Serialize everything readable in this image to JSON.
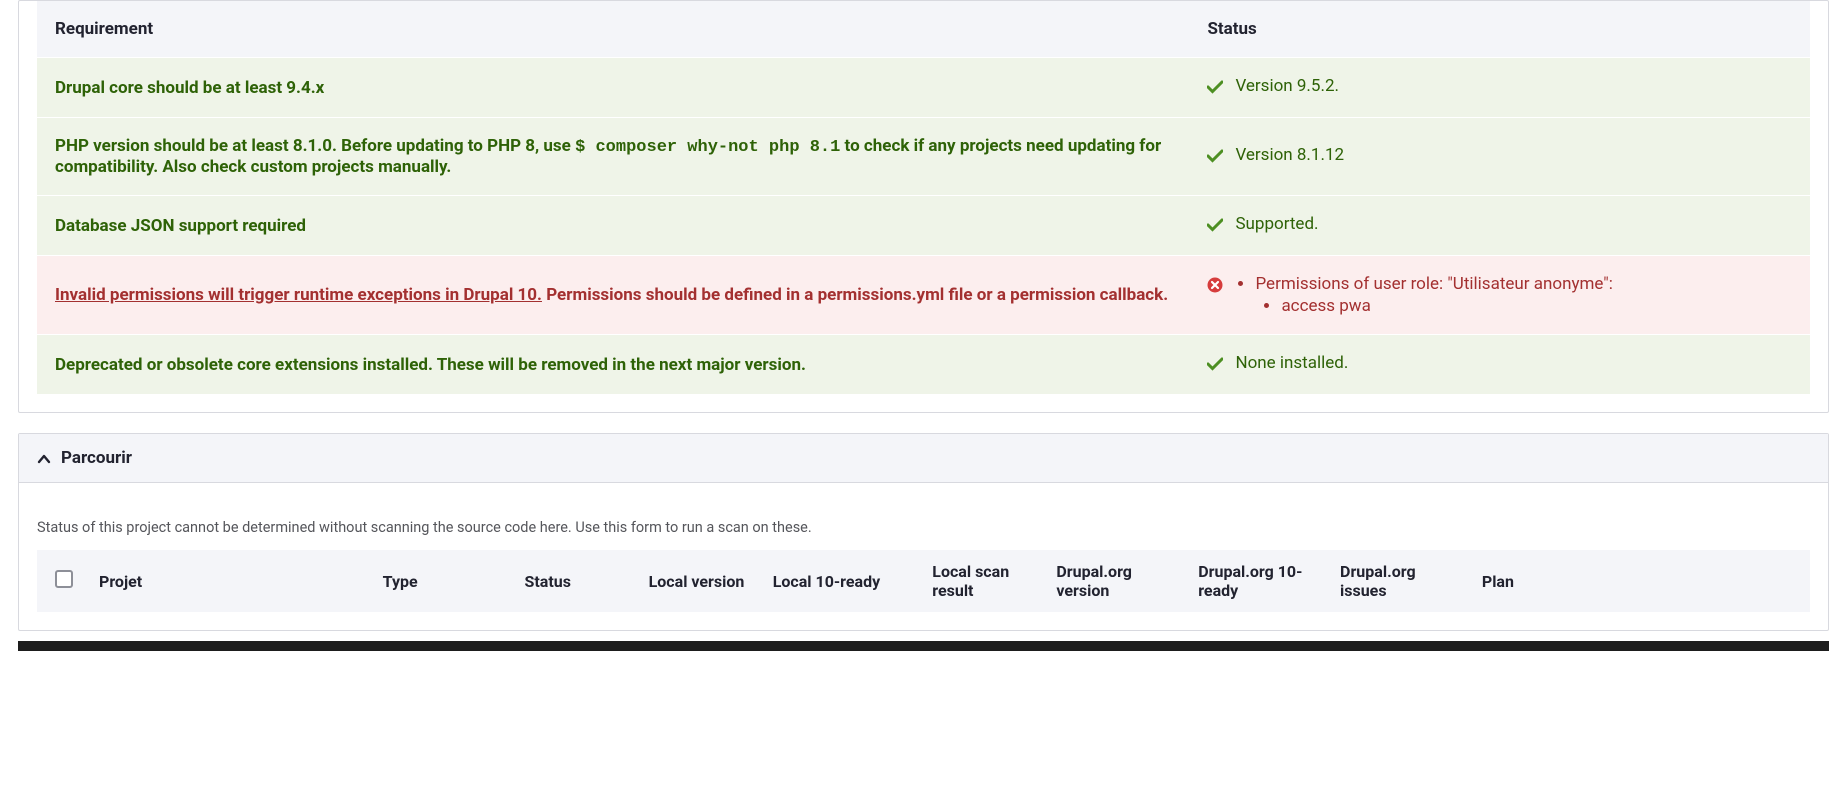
{
  "requirements": {
    "headers": {
      "requirement": "Requirement",
      "status": "Status"
    },
    "rows": [
      {
        "status": "ok",
        "req_plain": "Drupal core should be at least 9.4.x",
        "status_text": "Version 9.5.2."
      },
      {
        "status": "ok",
        "req_pre": "PHP version should be at least 8.1.0. Before updating to PHP 8, use ",
        "req_code": "$ composer why-not php 8.1",
        "req_post": " to check if any projects need updating for compatibility. Also check custom projects manually.",
        "status_text": "Version 8.1.12"
      },
      {
        "status": "ok",
        "req_plain": "Database JSON support required",
        "status_text": "Supported."
      },
      {
        "status": "err",
        "req_link": "Invalid permissions will trigger runtime exceptions in Drupal 10.",
        "req_post": " Permissions should be defined in a permissions.yml file or a permission callback.",
        "status_list": {
          "top": "Permissions of user role: \"Utilisateur anonyme\":",
          "sub": "access pwa"
        }
      },
      {
        "status": "ok",
        "req_plain": "Deprecated or obsolete core extensions installed. These will be removed in the next major version.",
        "status_text": "None installed."
      }
    ]
  },
  "browse": {
    "title": "Parcourir",
    "description": "Status of this project cannot be determined without scanning the source code here. Use this form to run a scan on these.",
    "columns": {
      "projet": "Projet",
      "type": "Type",
      "status": "Status",
      "local_version": "Local version",
      "local_10_ready": "Local 10-ready",
      "local_scan_result": "Local scan result",
      "drupal_version": "Drupal.org version",
      "drupal_10_ready": "Drupal.org 10-ready",
      "drupal_issues": "Drupal.org issues",
      "plan": "Plan"
    }
  }
}
